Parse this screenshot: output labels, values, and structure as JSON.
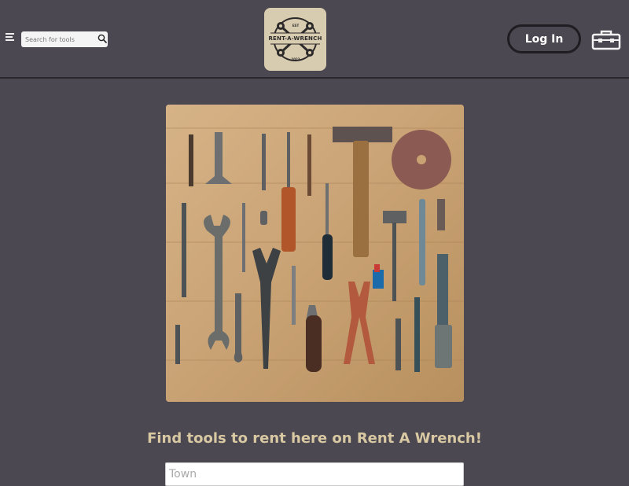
{
  "header": {
    "search": {
      "placeholder": "Search for tools",
      "value": ""
    },
    "logo": {
      "text": "RENT-A-WRENCH",
      "est": "EST",
      "year": "2023"
    },
    "login_label": "Log In"
  },
  "hero": {
    "image_alt": "Assorted vintage hand tools laid out on a wooden surface"
  },
  "main": {
    "tagline": "Find tools to rent here on Rent A Wrench!",
    "town_input": {
      "placeholder": "Town",
      "value": ""
    }
  },
  "colors": {
    "background": "#4c4851",
    "logo_bg": "#d8ccb0",
    "tagline": "#d9c9a3",
    "login_border": "#1f1d21"
  },
  "icons": [
    "menu-icon",
    "search-icon",
    "wrench-logo-icon",
    "toolbox-icon"
  ]
}
